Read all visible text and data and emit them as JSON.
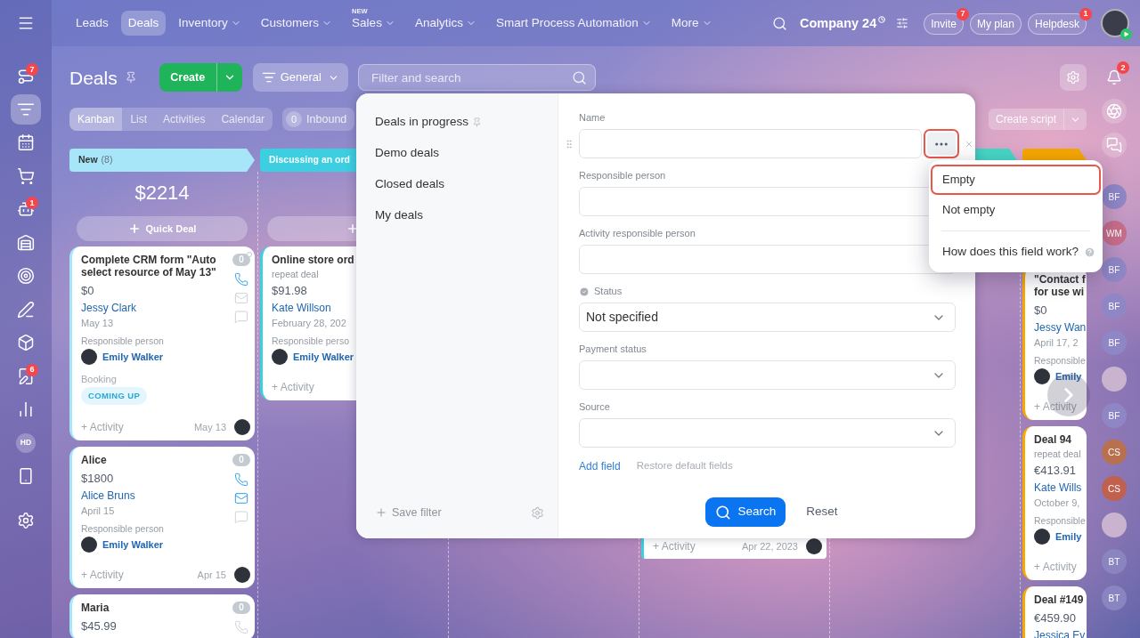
{
  "top_bar": {
    "nav": [
      {
        "label": "Leads",
        "selected": false,
        "has_menu": false
      },
      {
        "label": "Deals",
        "selected": true,
        "has_menu": false
      },
      {
        "label": "Inventory",
        "selected": false,
        "has_menu": true
      },
      {
        "label": "Customers",
        "selected": false,
        "has_menu": true
      },
      {
        "label": "Sales",
        "tag": "NEW",
        "selected": false,
        "has_menu": true
      },
      {
        "label": "Analytics",
        "selected": false,
        "has_menu": true
      },
      {
        "label": "Smart Process Automation",
        "selected": false,
        "has_menu": true
      },
      {
        "label": "More",
        "selected": false,
        "has_menu": true
      }
    ],
    "company": "Company 24",
    "buttons": [
      {
        "label": "Invite",
        "badge": "7"
      },
      {
        "label": "My plan"
      },
      {
        "label": "Helpdesk",
        "badge": "1"
      }
    ]
  },
  "left_sidebar": [
    {
      "kind": "flow",
      "badge": "7",
      "selected": false
    },
    {
      "kind": "funnel",
      "selected": true
    },
    {
      "kind": "calendar",
      "selected": false
    },
    {
      "kind": "cart",
      "selected": false
    },
    {
      "kind": "robot",
      "badge": "1",
      "selected": false
    },
    {
      "kind": "warehouse",
      "selected": false
    },
    {
      "kind": "target",
      "selected": false
    },
    {
      "kind": "signature",
      "selected": false
    },
    {
      "kind": "box",
      "selected": false
    },
    {
      "kind": "document",
      "badge": "6",
      "selected": false
    },
    {
      "kind": "chart",
      "selected": false
    },
    {
      "kind": "initials",
      "label": "HD",
      "selected": false
    },
    {
      "kind": "device",
      "selected": false
    },
    {
      "kind": "settings",
      "selected": false
    }
  ],
  "page": {
    "title": "Deals",
    "create": "Create",
    "category": "General",
    "search_placeholder": "Filter and search",
    "view_tabs": [
      {
        "label": "Kanban",
        "selected": true
      },
      {
        "label": "List",
        "selected": false
      },
      {
        "label": "Activities",
        "selected": false
      },
      {
        "label": "Calendar",
        "selected": false
      }
    ],
    "inbound": {
      "count": "0",
      "label": "Inbound"
    },
    "create_script": "Create script"
  },
  "columns": [
    {
      "title": "New",
      "count": "(8)",
      "color": "#a6e6f8",
      "total": "$2214",
      "quick_deal_button": true,
      "quick_deal_label": "Quick Deal",
      "cards": [
        {
          "title": "Complete CRM form \"Auto select resource of May 13\"",
          "amount": "$0",
          "client": "Jessy Clark",
          "date": "May 13",
          "responsible_label": "Responsible person",
          "responsible": "Emily Walker",
          "booking_label": "Booking",
          "booking_status": "COMING UP",
          "activity": "+ Activity",
          "activity_date": "May 13",
          "counter": "0",
          "unread": true,
          "channels": [
            {
              "kind": "call",
              "active": true
            },
            {
              "kind": "email",
              "active": false
            },
            {
              "kind": "chat",
              "active": false
            }
          ]
        },
        {
          "title": "Alice",
          "amount": "$1800",
          "client": "Alice Bruns",
          "date": "April 15",
          "responsible_label": "Responsible person",
          "responsible": "Emily Walker",
          "activity": "+ Activity",
          "activity_date": "Apr 15",
          "counter": "0",
          "unread": false,
          "channels": [
            {
              "kind": "call",
              "active": true
            },
            {
              "kind": "email",
              "active": true
            },
            {
              "kind": "chat",
              "active": false
            }
          ]
        },
        {
          "title": "Maria",
          "amount": "$45.99",
          "counter": "0",
          "unread": false,
          "channels": [
            {
              "kind": "call",
              "active": false
            }
          ]
        }
      ]
    },
    {
      "title": "Discussing an ord",
      "color": "#3ccfe1",
      "quick_deal_button": true,
      "cards": [
        {
          "title": "Online store ord",
          "subtitle": "repeat deal",
          "amount": "$91.98",
          "client": "Kate Willson",
          "date": "February 28, 202",
          "responsible_label": "Responsible perso",
          "responsible": "Emily Walker",
          "activity": "+ Activity"
        }
      ]
    },
    {},
    {
      "cards": [
        {
          "color": "#3ccfe1",
          "activity": "+ Activity",
          "activity_date": "Apr 22, 2023"
        }
      ]
    },
    {
      "color": "#45d8c6"
    },
    {
      "color": "#f7a700",
      "cards": [
        {
          "title": "\"Contact f\nfor use wi",
          "amount": "$0",
          "client": "Jessy Wan",
          "date": "April 17, 2",
          "responsible_label": "Responsible",
          "responsible": "Emily",
          "activity": "+ Activity"
        },
        {
          "title": "Deal 94",
          "subtitle": "repeat deal",
          "amount": "€413.91",
          "client": "Kate Wills",
          "date": "October 9,",
          "responsible_label": "Responsible",
          "responsible": "Emily",
          "activity": "+ Activity"
        },
        {
          "title": "Deal #149",
          "amount": "€459.90",
          "client": "Jessica Ev"
        }
      ]
    }
  ],
  "right_sidebar": {
    "tools": [
      {
        "kind": "bell",
        "badge": "2"
      },
      {
        "kind": "swirl"
      },
      {
        "kind": "chat"
      }
    ],
    "contacts": [
      {
        "kind": "initials",
        "initials": "BF",
        "color": "#8f86c6"
      },
      {
        "kind": "initials",
        "initials": "WM",
        "color": "#c66d8a"
      },
      {
        "kind": "initials",
        "initials": "BF",
        "color": "#8f86c6"
      },
      {
        "kind": "initials",
        "initials": "BF",
        "color": "#8f86c6"
      },
      {
        "kind": "initials",
        "initials": "BF",
        "color": "#8f86c6"
      },
      {
        "kind": "photo"
      },
      {
        "kind": "initials",
        "initials": "BF",
        "color": "#8f86c6"
      },
      {
        "kind": "initials",
        "initials": "CS",
        "color": "#b9704f"
      },
      {
        "kind": "initials",
        "initials": "CS",
        "color": "#c0604e"
      },
      {
        "kind": "photo"
      },
      {
        "kind": "initials",
        "initials": "BT",
        "color": "#8a84c0"
      },
      {
        "kind": "initials",
        "initials": "BT",
        "color": "#8a84c0"
      }
    ]
  },
  "filter_panel": {
    "presets": [
      {
        "label": "Deals in progress",
        "pinned": true,
        "selected": false
      },
      {
        "label": "Demo deals",
        "pinned": false,
        "selected": false
      },
      {
        "label": "Closed deals",
        "pinned": false,
        "selected": false
      },
      {
        "label": "My deals",
        "pinned": false,
        "selected": false
      }
    ],
    "save_filter": "Save filter",
    "fields": [
      {
        "label": "Name",
        "kind": "text",
        "checked": false,
        "hovered": true
      },
      {
        "label": "Responsible person",
        "kind": "text",
        "checked": false,
        "hovered": false
      },
      {
        "label": "Activity responsible person",
        "kind": "text",
        "checked": false,
        "hovered": false
      },
      {
        "label": "Status",
        "kind": "select",
        "value": "Not specified",
        "checked": true,
        "hovered": false
      },
      {
        "label": "Payment status",
        "kind": "select",
        "checked": false,
        "hovered": false
      },
      {
        "label": "Source",
        "kind": "select",
        "checked": false,
        "hovered": false
      }
    ],
    "more_button": {
      "highlighted": true
    },
    "add_field": "Add field",
    "restore_fields": "Restore default fields",
    "search_button": "Search",
    "reset_button": "Reset",
    "field_menu": {
      "options": [
        {
          "label": "Empty",
          "highlighted": true
        },
        {
          "label": "Not empty",
          "highlighted": false
        }
      ],
      "help": "How does this field work?"
    }
  }
}
